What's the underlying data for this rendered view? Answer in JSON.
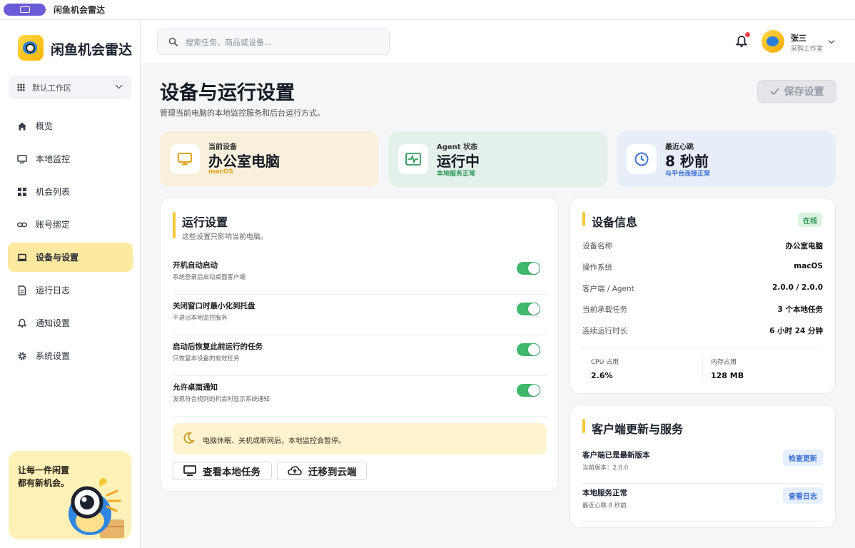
{
  "window": {
    "title": "闲鱼机会雷达"
  },
  "brand": {
    "name": "闲鱼机会雷达"
  },
  "workspace": {
    "label": "默认工作区"
  },
  "nav": [
    {
      "label": "概览",
      "icon": "home-icon"
    },
    {
      "label": "本地监控",
      "icon": "monitor-icon"
    },
    {
      "label": "机会列表",
      "icon": "grid-icon"
    },
    {
      "label": "账号绑定",
      "icon": "link-icon"
    },
    {
      "label": "设备与设置",
      "icon": "laptop-icon",
      "active": true
    },
    {
      "label": "运行日志",
      "icon": "document-icon"
    },
    {
      "label": "通知设置",
      "icon": "bell-icon"
    },
    {
      "label": "系统设置",
      "icon": "gear-icon"
    }
  ],
  "promo": {
    "text": "让每一件闲置\n都有新机会。"
  },
  "search": {
    "placeholder": "搜索任务、商品或设备..."
  },
  "user": {
    "name": "张三",
    "role": "采购工作室"
  },
  "page": {
    "title": "设备与运行设置",
    "subtitle": "管理当前电脑的本地监控服务和后台运行方式。",
    "save_label": "保存设置"
  },
  "stats": [
    {
      "label": "当前设备",
      "value": "办公室电脑",
      "sub": "macOS",
      "icon": "monitor-icon",
      "bg": "#f8f0da",
      "accent": "#e2a21a"
    },
    {
      "label": "Agent 状态",
      "value": "运行中",
      "sub": "本地服务正常",
      "icon": "pulse-icon",
      "bg": "#e4f1ea",
      "accent": "#2f9a58"
    },
    {
      "label": "最近心跳",
      "value": "8 秒前",
      "sub": "与平台连接正常",
      "icon": "clock-icon",
      "bg": "#e7eef9",
      "accent": "#3b72d6"
    }
  ],
  "run_settings": {
    "title": "运行设置",
    "subtitle": "这些设置只影响当前电脑。",
    "items": [
      {
        "label": "开机自动启动",
        "desc": "系统登录后启动桌面客户端",
        "enabled": true
      },
      {
        "label": "关闭窗口时最小化到托盘",
        "desc": "不退出本地监控服务",
        "enabled": true
      },
      {
        "label": "启动后恢复此前运行的任务",
        "desc": "只恢复本设备的有效任务",
        "enabled": true
      },
      {
        "label": "允许桌面通知",
        "desc": "发现符合规则的机会时显示系统通知",
        "enabled": true
      }
    ],
    "tip": "电脑休眠、关机或断网后，本地监控会暂停。",
    "btn_local": "查看本地任务",
    "btn_cloud": "迁移到云端"
  },
  "device_info": {
    "title": "设备信息",
    "badge": "在线",
    "rows": [
      {
        "key": "设备名称",
        "value": "办公室电脑"
      },
      {
        "key": "操作系统",
        "value": "macOS"
      },
      {
        "key": "客户端 / Agent",
        "value": "2.0.0 / 2.0.0"
      },
      {
        "key": "当前承载任务",
        "value": "3 个本地任务"
      },
      {
        "key": "连续运行时长",
        "value": "6 小时 24 分钟"
      }
    ],
    "cpu_label": "CPU 占用",
    "cpu_value": "2.6%",
    "mem_label": "内存占用",
    "mem_value": "128 MB"
  },
  "update_service": {
    "title": "客户端更新与服务",
    "rows": [
      {
        "title": "客户端已是最新版本",
        "sub": "当前版本：2.0.0",
        "btn": "检查更新"
      },
      {
        "title": "本地服务正常",
        "sub": "最近心跳 8 秒前",
        "btn": "查看日志"
      }
    ]
  }
}
